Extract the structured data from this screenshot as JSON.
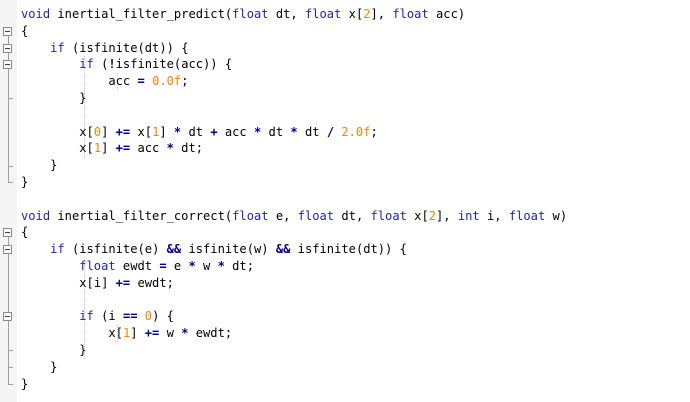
{
  "editor": {
    "lines": [
      [
        [
          "keyword",
          "void"
        ],
        [
          "ident",
          " inertial_filter_predict"
        ],
        [
          "punct",
          "("
        ],
        [
          "type",
          "float"
        ],
        [
          "ident",
          " dt"
        ],
        [
          "punct",
          ", "
        ],
        [
          "type",
          "float"
        ],
        [
          "ident",
          " x"
        ],
        [
          "punct",
          "["
        ],
        [
          "number",
          "2"
        ],
        [
          "punct",
          "], "
        ],
        [
          "type",
          "float"
        ],
        [
          "ident",
          " acc"
        ],
        [
          "punct",
          ")"
        ]
      ],
      [
        [
          "punct",
          "{"
        ]
      ],
      [
        [
          "ident",
          "    "
        ],
        [
          "keyword",
          "if"
        ],
        [
          "ident",
          " "
        ],
        [
          "punct",
          "("
        ],
        [
          "ident",
          "isfinite"
        ],
        [
          "punct",
          "("
        ],
        [
          "ident",
          "dt"
        ],
        [
          "punct",
          "))"
        ],
        [
          "ident",
          " "
        ],
        [
          "punct",
          "{"
        ]
      ],
      [
        [
          "ident",
          "        "
        ],
        [
          "keyword",
          "if"
        ],
        [
          "ident",
          " "
        ],
        [
          "punct",
          "("
        ],
        [
          "op",
          "!"
        ],
        [
          "ident",
          "isfinite"
        ],
        [
          "punct",
          "("
        ],
        [
          "ident",
          "acc"
        ],
        [
          "punct",
          "))"
        ],
        [
          "ident",
          " "
        ],
        [
          "punct",
          "{"
        ]
      ],
      [
        [
          "ident",
          "            acc "
        ],
        [
          "op",
          "="
        ],
        [
          "ident",
          " "
        ],
        [
          "number",
          "0.0f"
        ],
        [
          "punct",
          ";"
        ]
      ],
      [
        [
          "ident",
          "        "
        ],
        [
          "punct",
          "}"
        ]
      ],
      [],
      [
        [
          "ident",
          "        x"
        ],
        [
          "punct",
          "["
        ],
        [
          "number",
          "0"
        ],
        [
          "punct",
          "]"
        ],
        [
          "ident",
          " "
        ],
        [
          "op",
          "+="
        ],
        [
          "ident",
          " x"
        ],
        [
          "punct",
          "["
        ],
        [
          "number",
          "1"
        ],
        [
          "punct",
          "]"
        ],
        [
          "ident",
          " "
        ],
        [
          "op",
          "*"
        ],
        [
          "ident",
          " dt "
        ],
        [
          "op",
          "+"
        ],
        [
          "ident",
          " acc "
        ],
        [
          "op",
          "*"
        ],
        [
          "ident",
          " dt "
        ],
        [
          "op",
          "*"
        ],
        [
          "ident",
          " dt "
        ],
        [
          "op",
          "/"
        ],
        [
          "ident",
          " "
        ],
        [
          "number",
          "2.0f"
        ],
        [
          "punct",
          ";"
        ]
      ],
      [
        [
          "ident",
          "        x"
        ],
        [
          "punct",
          "["
        ],
        [
          "number",
          "1"
        ],
        [
          "punct",
          "]"
        ],
        [
          "ident",
          " "
        ],
        [
          "op",
          "+="
        ],
        [
          "ident",
          " acc "
        ],
        [
          "op",
          "*"
        ],
        [
          "ident",
          " dt"
        ],
        [
          "punct",
          ";"
        ]
      ],
      [
        [
          "ident",
          "    "
        ],
        [
          "punct",
          "}"
        ]
      ],
      [
        [
          "punct",
          "}"
        ]
      ],
      [],
      [
        [
          "keyword",
          "void"
        ],
        [
          "ident",
          " inertial_filter_correct"
        ],
        [
          "punct",
          "("
        ],
        [
          "type",
          "float"
        ],
        [
          "ident",
          " e"
        ],
        [
          "punct",
          ", "
        ],
        [
          "type",
          "float"
        ],
        [
          "ident",
          " dt"
        ],
        [
          "punct",
          ", "
        ],
        [
          "type",
          "float"
        ],
        [
          "ident",
          " x"
        ],
        [
          "punct",
          "["
        ],
        [
          "number",
          "2"
        ],
        [
          "punct",
          "], "
        ],
        [
          "type",
          "int"
        ],
        [
          "ident",
          " i"
        ],
        [
          "punct",
          ", "
        ],
        [
          "type",
          "float"
        ],
        [
          "ident",
          " w"
        ],
        [
          "punct",
          ")"
        ]
      ],
      [
        [
          "punct",
          "{"
        ]
      ],
      [
        [
          "ident",
          "    "
        ],
        [
          "keyword",
          "if"
        ],
        [
          "ident",
          " "
        ],
        [
          "punct",
          "("
        ],
        [
          "ident",
          "isfinite"
        ],
        [
          "punct",
          "("
        ],
        [
          "ident",
          "e"
        ],
        [
          "punct",
          ")"
        ],
        [
          "ident",
          " "
        ],
        [
          "op",
          "&&"
        ],
        [
          "ident",
          " isfinite"
        ],
        [
          "punct",
          "("
        ],
        [
          "ident",
          "w"
        ],
        [
          "punct",
          ")"
        ],
        [
          "ident",
          " "
        ],
        [
          "op",
          "&&"
        ],
        [
          "ident",
          " isfinite"
        ],
        [
          "punct",
          "("
        ],
        [
          "ident",
          "dt"
        ],
        [
          "punct",
          "))"
        ],
        [
          "ident",
          " "
        ],
        [
          "punct",
          "{"
        ]
      ],
      [
        [
          "ident",
          "        "
        ],
        [
          "type",
          "float"
        ],
        [
          "ident",
          " ewdt "
        ],
        [
          "op",
          "="
        ],
        [
          "ident",
          " e "
        ],
        [
          "op",
          "*"
        ],
        [
          "ident",
          " w "
        ],
        [
          "op",
          "*"
        ],
        [
          "ident",
          " dt"
        ],
        [
          "punct",
          ";"
        ]
      ],
      [
        [
          "ident",
          "        x"
        ],
        [
          "punct",
          "["
        ],
        [
          "ident",
          "i"
        ],
        [
          "punct",
          "]"
        ],
        [
          "ident",
          " "
        ],
        [
          "op",
          "+="
        ],
        [
          "ident",
          " ewdt"
        ],
        [
          "punct",
          ";"
        ]
      ],
      [],
      [
        [
          "ident",
          "        "
        ],
        [
          "keyword",
          "if"
        ],
        [
          "ident",
          " "
        ],
        [
          "punct",
          "("
        ],
        [
          "ident",
          "i "
        ],
        [
          "op",
          "=="
        ],
        [
          "ident",
          " "
        ],
        [
          "number",
          "0"
        ],
        [
          "punct",
          ")"
        ],
        [
          "ident",
          " "
        ],
        [
          "punct",
          "{"
        ]
      ],
      [
        [
          "ident",
          "            x"
        ],
        [
          "punct",
          "["
        ],
        [
          "number",
          "1"
        ],
        [
          "punct",
          "]"
        ],
        [
          "ident",
          " "
        ],
        [
          "op",
          "+="
        ],
        [
          "ident",
          " w "
        ],
        [
          "op",
          "*"
        ],
        [
          "ident",
          " ewdt"
        ],
        [
          "punct",
          ";"
        ]
      ],
      [
        [
          "ident",
          "        "
        ],
        [
          "punct",
          "}"
        ]
      ],
      [
        [
          "ident",
          "    "
        ],
        [
          "punct",
          "}"
        ]
      ],
      [
        [
          "punct",
          "}"
        ]
      ]
    ],
    "folds": [
      {
        "start": 1,
        "end": 10
      },
      {
        "start": 2,
        "end": 9
      },
      {
        "start": 3,
        "end": 5
      },
      {
        "start": 13,
        "end": 22
      },
      {
        "start": 14,
        "end": 21
      },
      {
        "start": 18,
        "end": 20
      }
    ],
    "colors": {
      "keyword": "#1e24b8",
      "number": "#ff8000",
      "operator": "#000090",
      "identifier": "#000000",
      "background": "#ffffff",
      "gutter": "#f5f5f5"
    }
  }
}
